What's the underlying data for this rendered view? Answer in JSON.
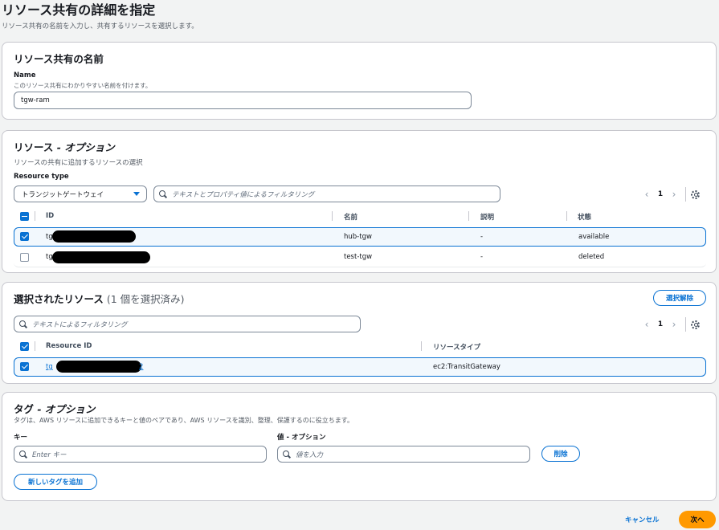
{
  "page": {
    "title": "リソース共有の詳細を指定",
    "description": "リソース共有の名前を入力し、共有するリソースを選択します。"
  },
  "name_panel": {
    "title": "リソース共有の名前",
    "field_label": "Name",
    "field_desc": "このリソース共有にわかりやすい名前を付けます。",
    "value": "tgw-ram"
  },
  "resources_panel": {
    "title": "リソース",
    "title_suffix": " - オプション",
    "description": "リソースの共有に追加するリソースの選択",
    "type_label": "Resource type",
    "type_value": "トランジットゲートウェイ",
    "filter_placeholder": "テキストとプロパティ値によるフィルタリング",
    "page_number": "1",
    "columns": [
      "ID",
      "名前",
      "説明",
      "状態"
    ],
    "rows": [
      {
        "id_prefix": "tg",
        "name": "hub-tgw",
        "desc": "-",
        "state": "available",
        "checked": true
      },
      {
        "id_prefix": "tg",
        "name": "test-tgw",
        "desc": "-",
        "state": "deleted",
        "checked": false
      }
    ]
  },
  "selected_panel": {
    "title": "選択されたリソース",
    "count": " (1 個を選択済み)",
    "deselect_label": "選択解除",
    "filter_placeholder": "テキストによるフィルタリング",
    "page_number": "1",
    "columns": [
      "Resource ID",
      "リソースタイプ"
    ],
    "rows": [
      {
        "id_prefix": "tg",
        "id_suffix": "2",
        "type": "ec2:TransitGateway"
      }
    ]
  },
  "tags_panel": {
    "title": "タグ",
    "title_suffix": " - オプション",
    "description": "タグは、AWS リソースに追加できるキーと値のペアであり、AWS リソースを識別、整理、保護するのに役立ちます。",
    "key_label": "キー",
    "value_label": "値 - オプション",
    "key_placeholder": "Enter キー",
    "value_placeholder": "値を入力",
    "remove_label": "削除",
    "add_label": "新しいタグを追加"
  },
  "footer": {
    "cancel_label": "キャンセル",
    "next_label": "次へ"
  },
  "colors": {
    "accent": "#0972d3",
    "primary_button": "#ff9900"
  }
}
